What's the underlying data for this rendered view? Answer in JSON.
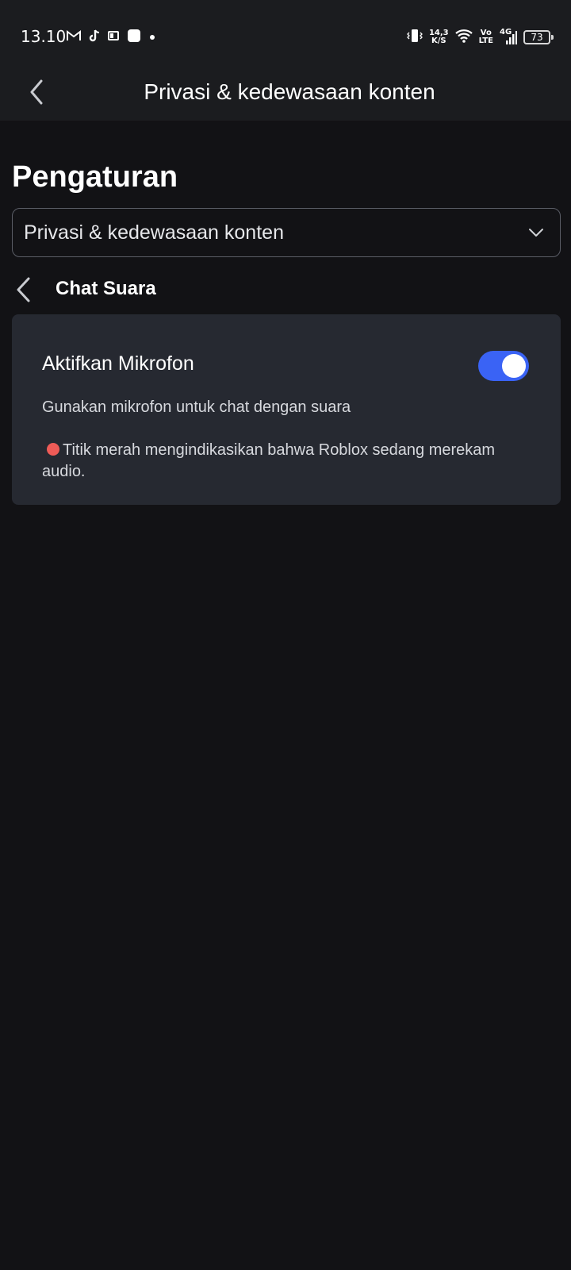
{
  "status_bar": {
    "time": "13.10",
    "left_icons": [
      "gmail-icon",
      "tiktok-icon",
      "outlook-icon",
      "app-square-icon",
      "dot-icon"
    ],
    "network_speed_value": "14,3",
    "network_speed_unit": "K/S",
    "volte_top": "Vo",
    "volte_bottom": "LTE",
    "network_type": "4G",
    "battery_level": "73"
  },
  "header": {
    "title": "Privasi & kedewasaan konten",
    "back_icon": "chevron-left-icon"
  },
  "settings": {
    "heading": "Pengaturan",
    "dropdown_value": "Privasi & kedewasaan konten",
    "dropdown_icon": "chevron-down-icon"
  },
  "subsection": {
    "title": "Chat Suara",
    "back_icon": "chevron-left-icon"
  },
  "microphone_setting": {
    "label": "Aktifkan Mikrofon",
    "enabled": true,
    "description": "Gunakan mikrofon untuk chat dengan suara",
    "note": "Titik merah mengindikasikan bahwa Roblox sedang merekam audio."
  },
  "colors": {
    "background": "#121215",
    "header_background": "#1b1c1f",
    "card_background": "#262931",
    "toggle_on": "#3a63f5",
    "recording_dot": "#ee5b57"
  }
}
